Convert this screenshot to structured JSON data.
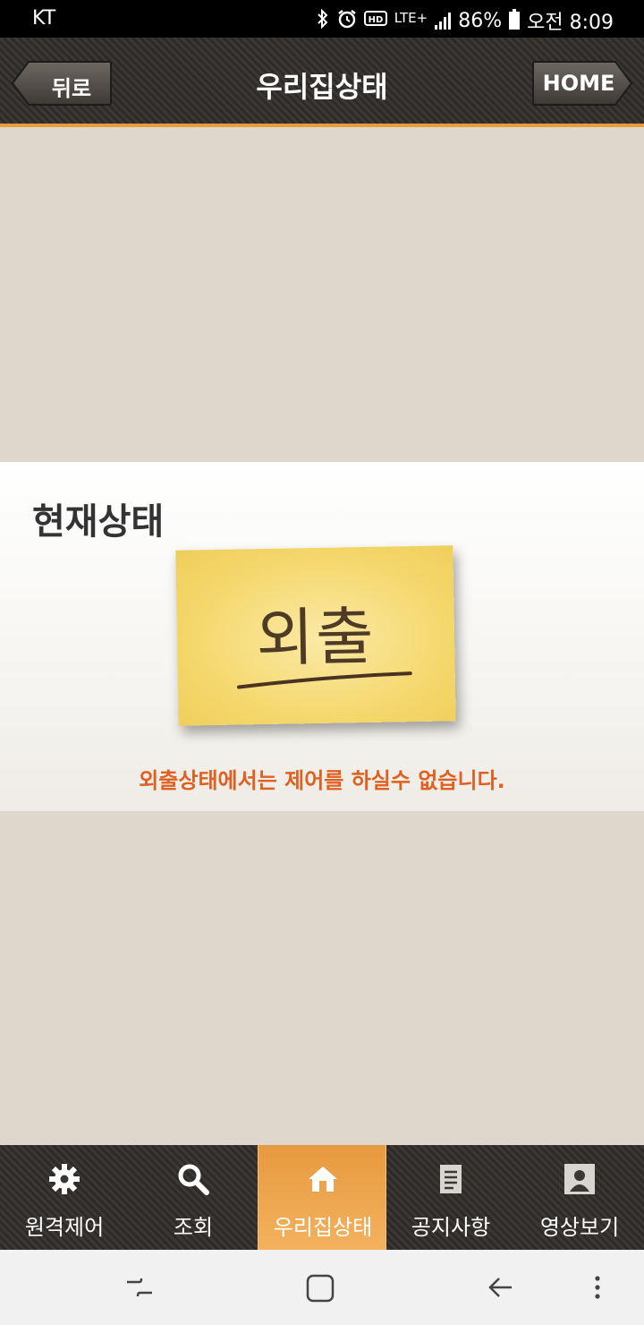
{
  "status_bar": {
    "carrier": "KT",
    "network": "LTE+",
    "battery": "86%",
    "time": "오전 8:09",
    "icons": [
      "bluetooth-icon",
      "alarm-icon",
      "hd-icon",
      "signal-icon",
      "battery-icon"
    ]
  },
  "header": {
    "title": "우리집상태",
    "back_label": "뒤로",
    "home_label": "HOME"
  },
  "status_panel": {
    "heading": "현재상태",
    "state": "외출",
    "message": "외출상태에서는 제어를 하실수 없습니다."
  },
  "tabs": [
    {
      "label": "원격제어",
      "icon": "gear-icon",
      "active": false
    },
    {
      "label": "조회",
      "icon": "search-icon",
      "active": false
    },
    {
      "label": "우리집상태",
      "icon": "house-icon",
      "active": true
    },
    {
      "label": "공지사항",
      "icon": "document-icon",
      "active": false
    },
    {
      "label": "영상보기",
      "icon": "user-portrait-icon",
      "active": false
    }
  ],
  "nav_bar": {
    "icons": [
      "recent-apps-icon",
      "home-icon",
      "back-icon",
      "more-icon"
    ]
  },
  "colors": {
    "accent": "#e99a3c",
    "message": "#e06022",
    "background": "#ddd7cc",
    "note": "#f4d76a"
  }
}
